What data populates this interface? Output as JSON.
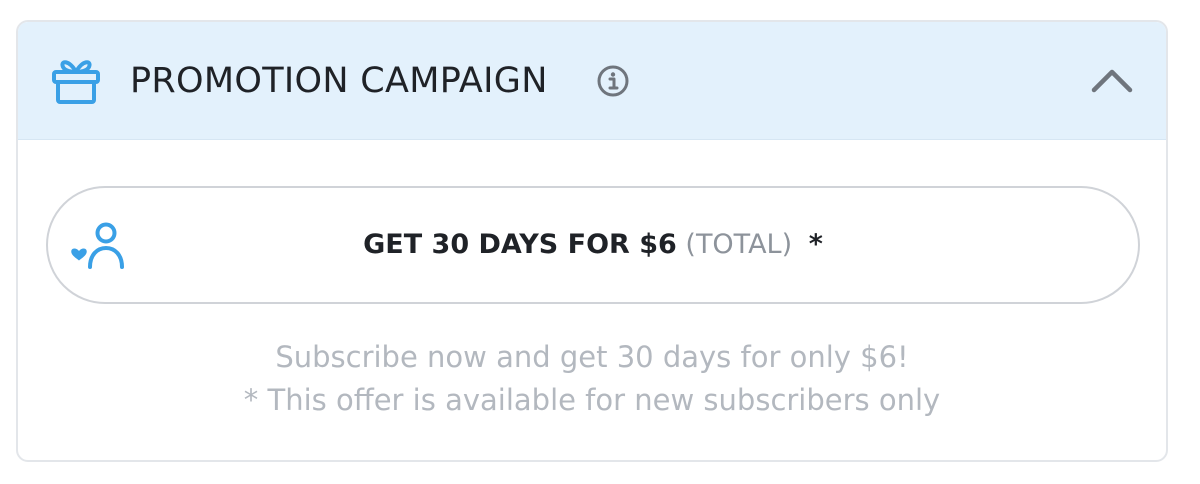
{
  "colors": {
    "accent_icon": "#3aa0e6",
    "header_background": "#e3f1fc",
    "title_text": "#1f2227",
    "muted_text": "#b3b8bf",
    "secondary_text": "#8d939b",
    "border": "#d0d3d8"
  },
  "header": {
    "icon": "gift-icon",
    "title": "PROMOTION CAMPAIGN",
    "info_icon": "info-icon",
    "toggle_icon": "chevron-up-icon"
  },
  "offer": {
    "icon": "user-heart-icon",
    "main_label": "GET 30 DAYS FOR $6",
    "sub_label": "(TOTAL)",
    "footnote_marker": "*"
  },
  "description": {
    "line1": "Subscribe now and get 30 days for only $6!",
    "line2": "* This offer is available for new subscribers only"
  }
}
